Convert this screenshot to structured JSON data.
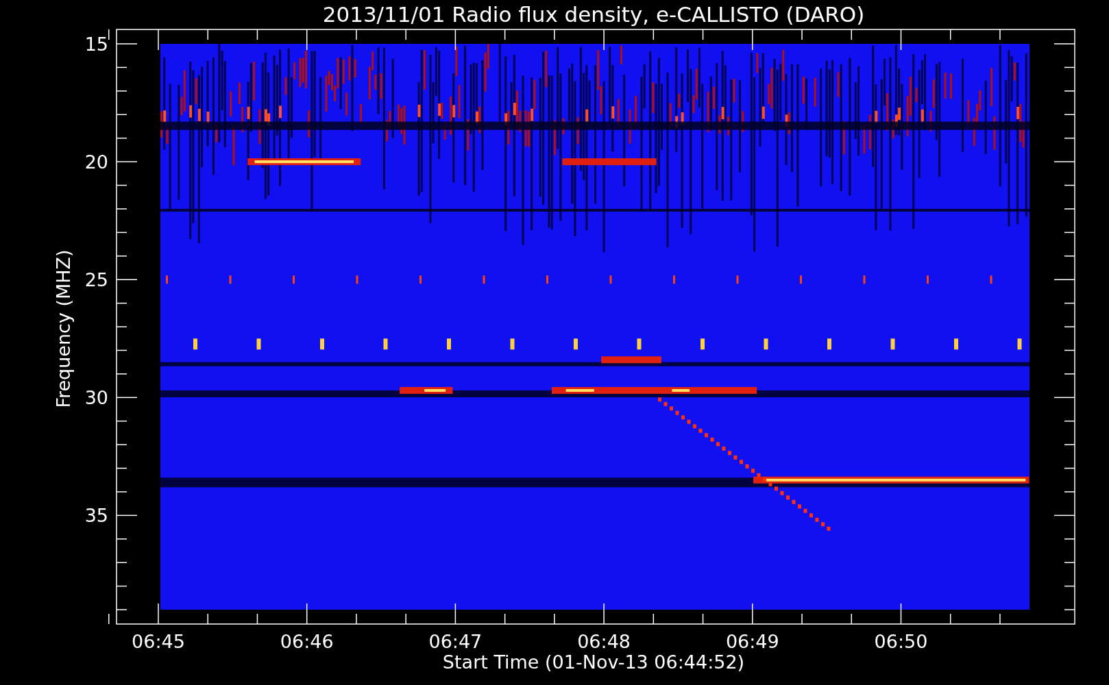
{
  "title": "2013/11/01  Radio flux density, e-CALLISTO (DARO)",
  "y_axis": {
    "label": "Frequency (MHZ)",
    "ticks": [
      "15",
      "20",
      "25",
      "30",
      "35"
    ]
  },
  "x_axis": {
    "label": "Start Time (01-Nov-13 06:44:52)",
    "ticks": [
      "06:45",
      "06:46",
      "06:47",
      "06:48",
      "06:49",
      "06:50"
    ]
  }
}
